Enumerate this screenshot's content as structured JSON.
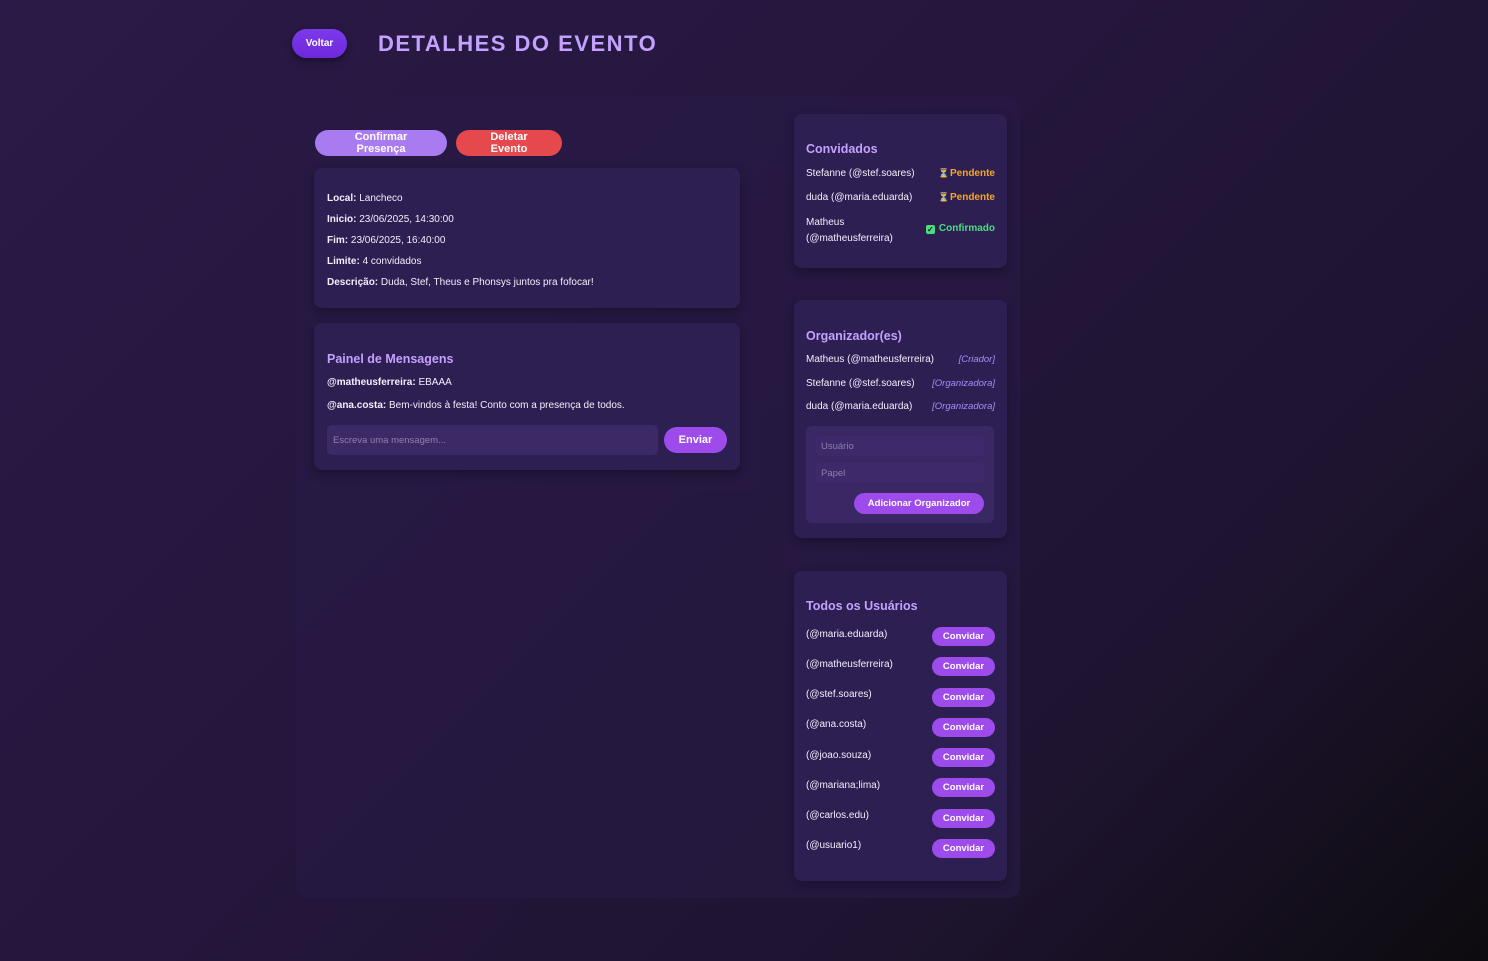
{
  "header": {
    "back_label": "Voltar",
    "title": "DETALHES DO EVENTO"
  },
  "actions": {
    "confirm_label": "Confirmar Presença",
    "delete_label": "Deletar Evento"
  },
  "details": {
    "local_label": "Local:",
    "local": "Lancheco",
    "inicio_label": "Inicio:",
    "inicio": "23/06/2025, 14:30:00",
    "fim_label": "Fim:",
    "fim": "23/06/2025, 16:40:00",
    "limite_label": "Limite:",
    "limite": "4 convidados",
    "descricao_label": "Descrição:",
    "descricao": "Duda, Stef, Theus e Phonsys juntos pra fofocar!"
  },
  "messages": {
    "title": "Painel de Mensagens",
    "items": [
      {
        "user": "@matheusferreira:",
        "text": "EBAAA"
      },
      {
        "user": "@ana.costa:",
        "text": "Bem-vindos à festa! Conto com a presença de todos."
      }
    ],
    "placeholder": "Escreva uma mensagem...",
    "send_label": "Enviar"
  },
  "guests": {
    "title": "Convidados",
    "items": [
      {
        "name": "Stefanne (@stef.soares)",
        "status": "Pendente",
        "status_icon": "hourglass-icon"
      },
      {
        "name": "duda (@maria.eduarda)",
        "status": "Pendente",
        "status_icon": "hourglass-icon"
      },
      {
        "name_line1": "Matheus",
        "name_line2": "(@matheusferreira)",
        "status": "Confirmado",
        "status_icon": "check-icon"
      }
    ]
  },
  "organizers": {
    "title": "Organizador(es)",
    "items": [
      {
        "name": "Matheus (@matheusferreira)",
        "role": "[Criador]"
      },
      {
        "name": "Stefanne (@stef.soares)",
        "role": "[Organizadora]"
      },
      {
        "name": "duda (@maria.eduarda)",
        "role": "[Organizadora]"
      }
    ],
    "user_placeholder": "Usuário",
    "role_placeholder": "Papel",
    "add_label": "Adicionar Organizador"
  },
  "users": {
    "title": "Todos os Usuários",
    "invite_label": "Convidar",
    "items": [
      "(@maria.eduarda)",
      "(@matheusferreira)",
      "(@stef.soares)",
      "(@ana.costa)",
      "(@joao.souza)",
      "(@mariana;lima)",
      "(@carlos.edu)",
      "(@usuario1)"
    ]
  },
  "colors": {
    "accent": "#9d4bea",
    "title": "#c4a1ff",
    "danger": "#e5484d",
    "pending": "#f5a623",
    "confirmed": "#4ade80"
  }
}
